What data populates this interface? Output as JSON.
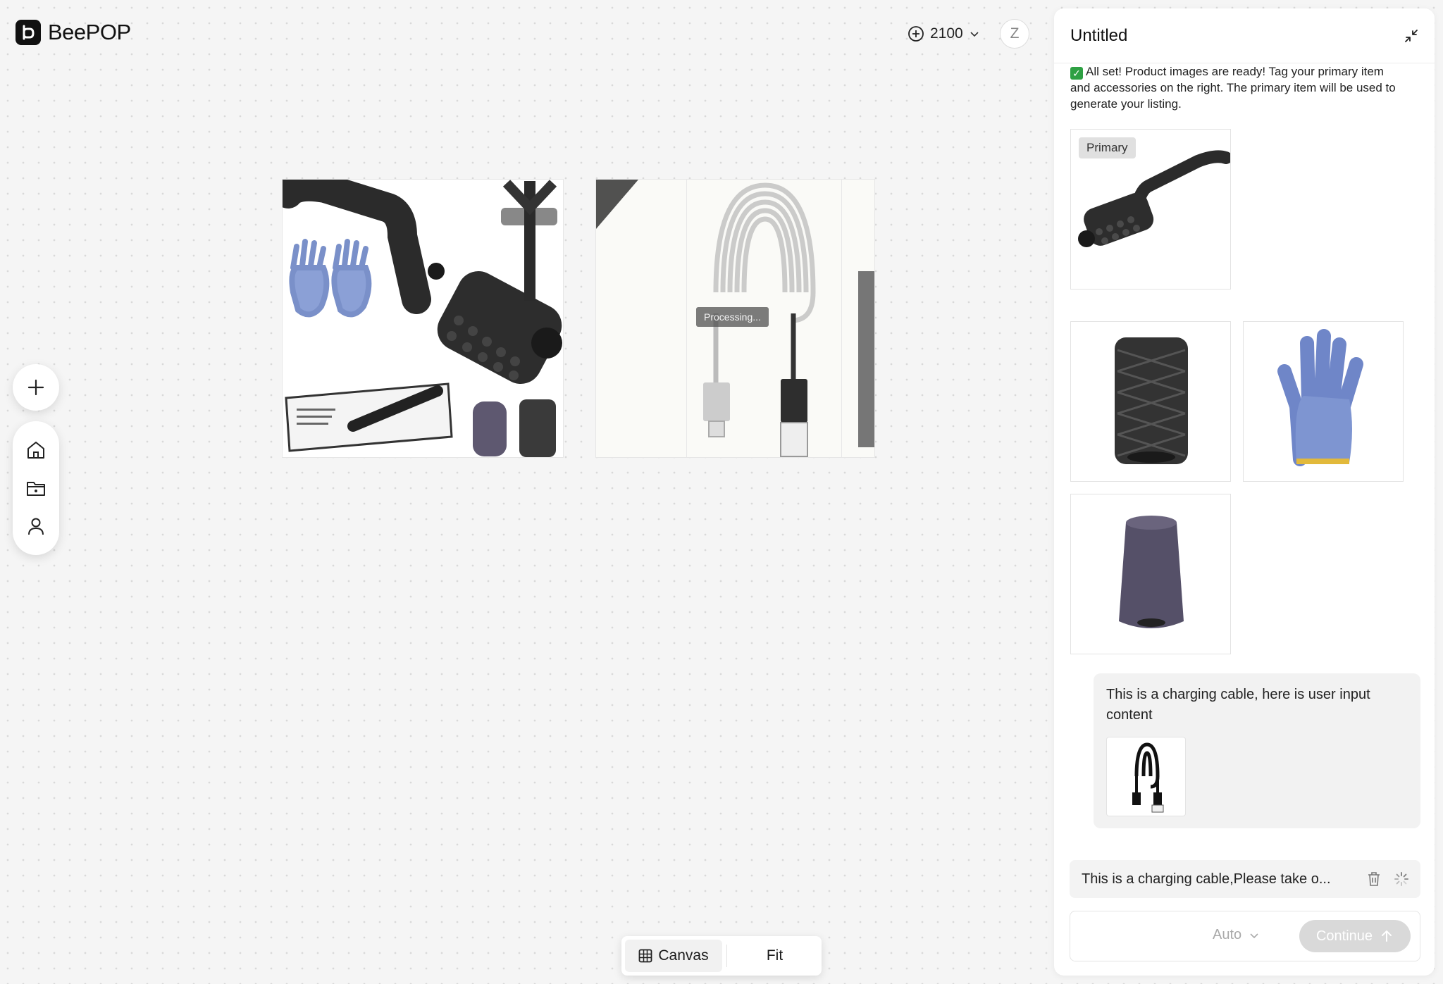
{
  "app": {
    "name": "BeePOP"
  },
  "header": {
    "credits": "2100",
    "avatar_initial": "Z"
  },
  "canvas": {
    "processing_label": "Processing..."
  },
  "bottom_bar": {
    "canvas_label": "Canvas",
    "fit_label": "Fit"
  },
  "panel": {
    "title": "Untitled",
    "status_message": "All set! Product images are ready! Tag your primary item and accessories on the right. The primary item will be used to generate your listing.",
    "primary_tag": "Primary",
    "user_message": "This is a charging cable, here is user input content",
    "task_text": "This is a charging cable,Please take o...",
    "mode_label": "Auto",
    "continue_label": "Continue"
  }
}
